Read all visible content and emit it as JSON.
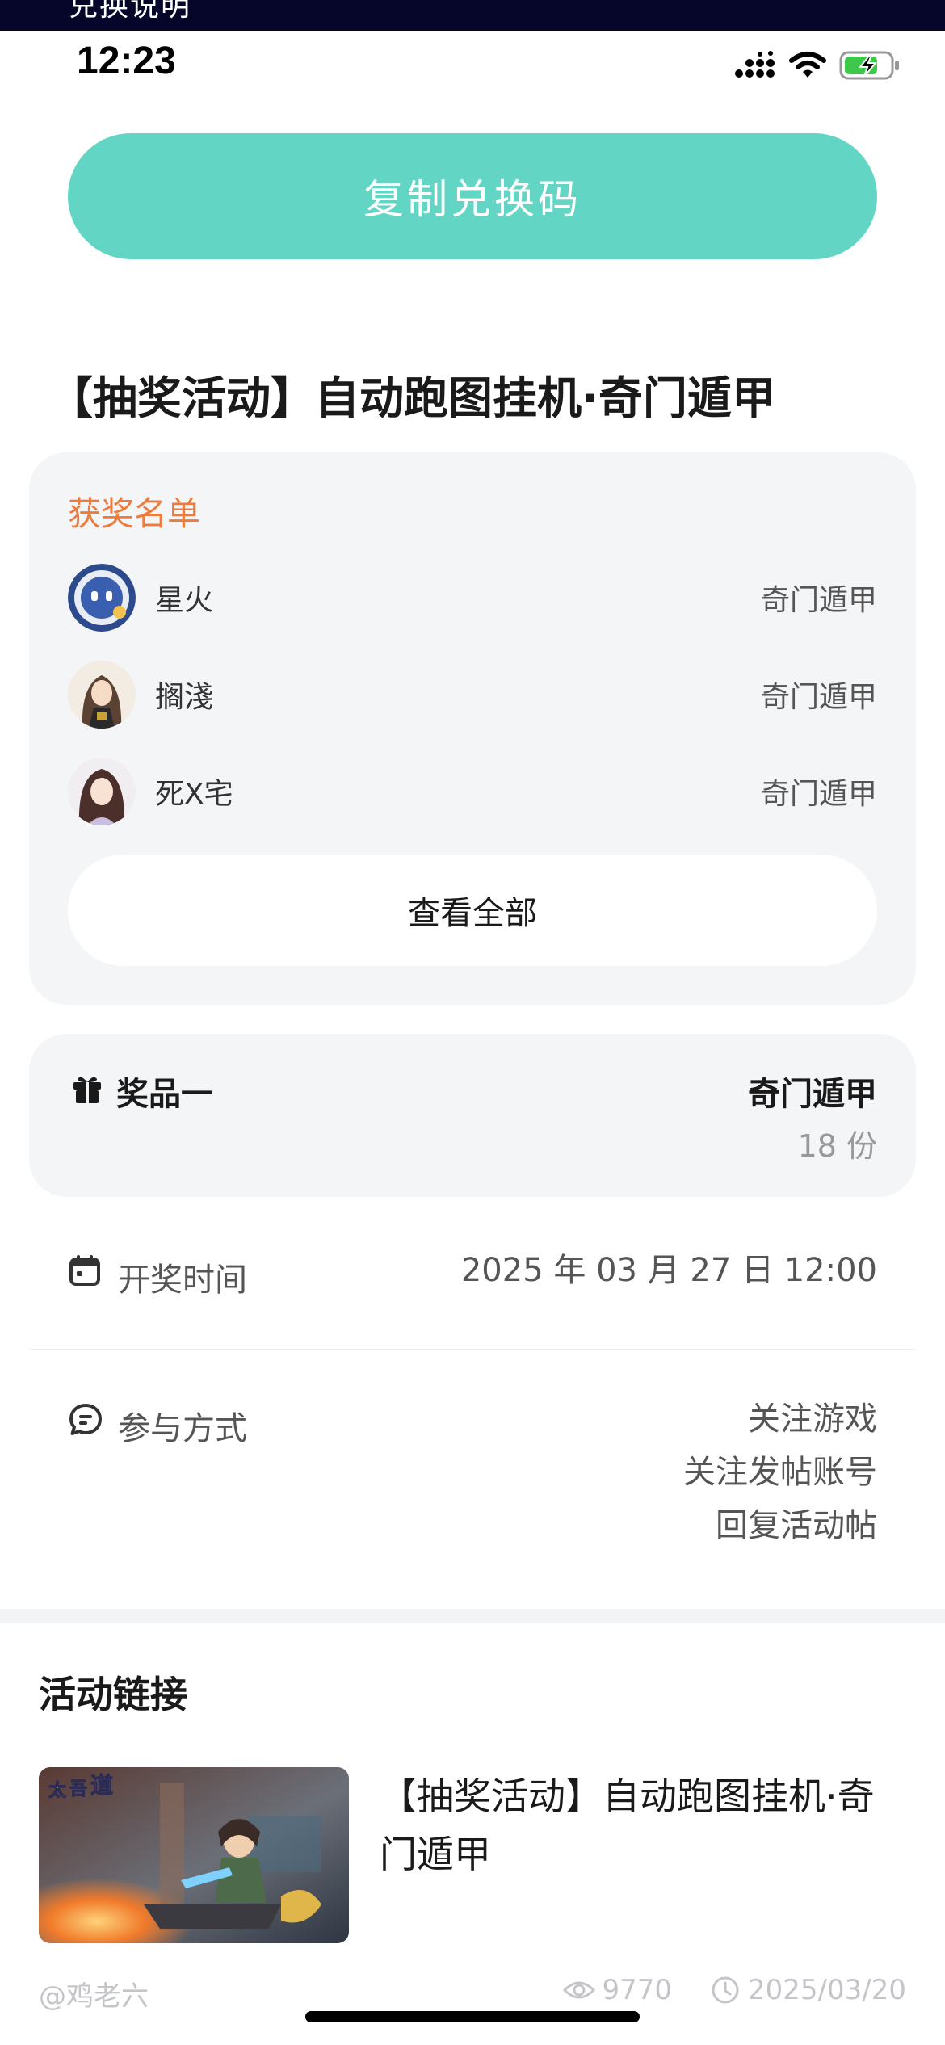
{
  "top_banner": {
    "text": "兑换说明"
  },
  "status_bar": {
    "time": "12:23"
  },
  "copy_button": {
    "label": "复制兑换码"
  },
  "post": {
    "title": "【抽奖活动】自动跑图挂机·奇门遁甲"
  },
  "winners": {
    "heading": "获奖名单",
    "list": [
      {
        "name": "星火",
        "prize": "奇门遁甲"
      },
      {
        "name": "搁淺",
        "prize": "奇门遁甲"
      },
      {
        "name": "死X宅",
        "prize": "奇门遁甲"
      }
    ],
    "view_all_label": "查看全部"
  },
  "prize": {
    "label": "奖品一",
    "name": "奇门遁甲",
    "quantity": "18 份"
  },
  "draw_time": {
    "label": "开奖时间",
    "value": "2025 年 03 月 27 日 12:00"
  },
  "participation": {
    "label": "参与方式",
    "methods": [
      "关注游戏",
      "关注发帖账号",
      "回复活动帖"
    ]
  },
  "activity_link": {
    "section_title": "活动链接",
    "title": "【抽奖活动】自动跑图挂机·奇门遁甲",
    "author": "@鸡老六",
    "views": "9770",
    "date": "2025/03/20"
  },
  "colors": {
    "accent": "#63d5c5",
    "winners_heading": "#ec7b3d",
    "card_bg": "#f4f5f7"
  }
}
